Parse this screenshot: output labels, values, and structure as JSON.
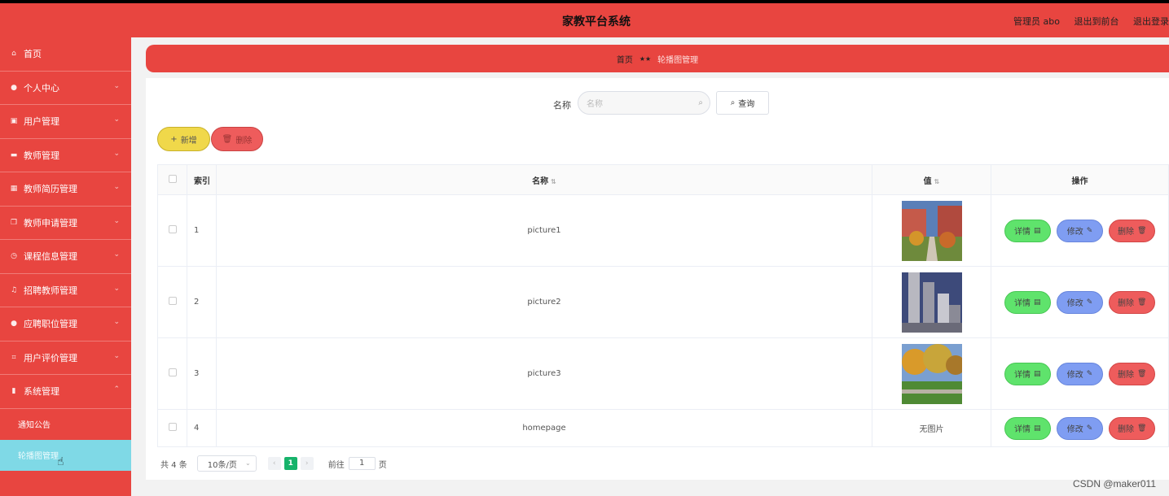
{
  "header": {
    "title": "家教平台系统",
    "admin": "管理员 abo",
    "to_front": "退出到前台",
    "logout": "退出登录"
  },
  "sidebar": {
    "items": [
      {
        "label": "首页",
        "icon": "home-icon"
      },
      {
        "label": "个人中心",
        "icon": "user-icon"
      },
      {
        "label": "用户管理",
        "icon": "id-card-icon"
      },
      {
        "label": "教师管理",
        "icon": "briefcase-icon"
      },
      {
        "label": "教师简历管理",
        "icon": "grid-icon"
      },
      {
        "label": "教师申请管理",
        "icon": "copy-icon"
      },
      {
        "label": "课程信息管理",
        "icon": "clock-icon"
      },
      {
        "label": "招聘教师管理",
        "icon": "bell-icon"
      },
      {
        "label": "应聘职位管理",
        "icon": "user-icon"
      },
      {
        "label": "用户评价管理",
        "icon": "crop-icon"
      },
      {
        "label": "系统管理",
        "icon": "chart-icon"
      }
    ],
    "sub_items": [
      "通知公告",
      "轮播图管理"
    ]
  },
  "breadcrumb": {
    "home": "首页",
    "current": "轮播图管理"
  },
  "search": {
    "label": "名称",
    "placeholder": "名称",
    "query_label": "查询"
  },
  "actions": {
    "add_label": "新增",
    "delete_label": "删除"
  },
  "table": {
    "headers": {
      "index": "索引",
      "name": "名称",
      "value": "值",
      "ops": "操作"
    },
    "rows": [
      {
        "index": "1",
        "name": "picture1",
        "value": ""
      },
      {
        "index": "2",
        "name": "picture2",
        "value": ""
      },
      {
        "index": "3",
        "name": "picture3",
        "value": ""
      },
      {
        "index": "4",
        "name": "homepage",
        "value": "无图片"
      }
    ],
    "op_labels": {
      "detail": "详情",
      "edit": "修改",
      "remove": "删除"
    }
  },
  "pager": {
    "total": "共 4 条",
    "size": "10条/页",
    "page": "1",
    "goto": "前往",
    "goto_value": "1",
    "page_word": "页"
  },
  "watermark": "CSDN @maker011",
  "colors": {
    "primary": "#e84540",
    "active_sub": "#7fd9e6",
    "pager_active": "#17b36b"
  }
}
